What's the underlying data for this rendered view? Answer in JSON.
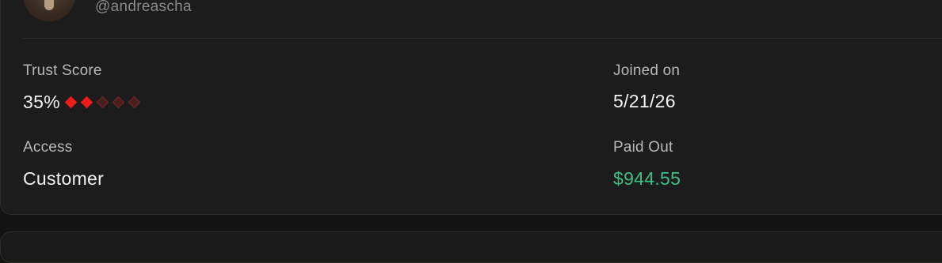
{
  "profile": {
    "handle": "@andreascha"
  },
  "stats": {
    "trust_score": {
      "label": "Trust Score",
      "value": "35%",
      "rating_filled": 2,
      "rating_total": 5
    },
    "joined": {
      "label": "Joined on",
      "value": "5/21/26"
    },
    "access": {
      "label": "Access",
      "value": "Customer"
    },
    "paid_out": {
      "label": "Paid Out",
      "value": "$944.55"
    }
  },
  "colors": {
    "paid_out_value": "#3fbf86",
    "rating_on": "#ee1b1b",
    "rating_off": "#4a1e1e"
  }
}
